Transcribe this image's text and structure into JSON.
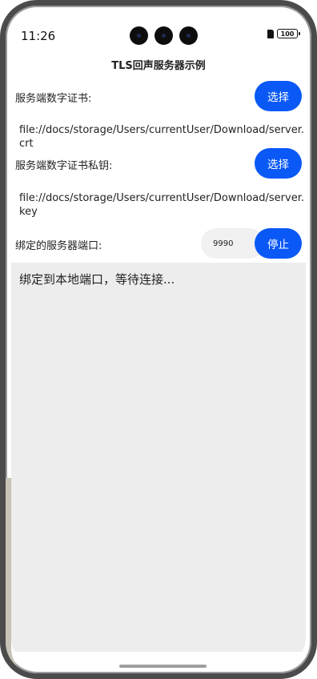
{
  "status_bar": {
    "time": "11:26",
    "battery": "100"
  },
  "app": {
    "title": "TLS回声服务器示例"
  },
  "cert": {
    "label": "服务端数字证书:",
    "button_label": "选择",
    "path": "file://docs/storage/Users/currentUser/Download/server.crt"
  },
  "key": {
    "label": "服务端数字证书私钥:",
    "button_label": "选择",
    "path": "file://docs/storage/Users/currentUser/Download/server.key"
  },
  "port": {
    "label": "绑定的服务器端口:",
    "value": "9990",
    "button_label": "停止"
  },
  "log": {
    "text": "绑定到本地端口，等待连接..."
  },
  "colors": {
    "accent": "#0a59f7",
    "log_background": "#ededed",
    "input_background": "#f1f1f1"
  }
}
